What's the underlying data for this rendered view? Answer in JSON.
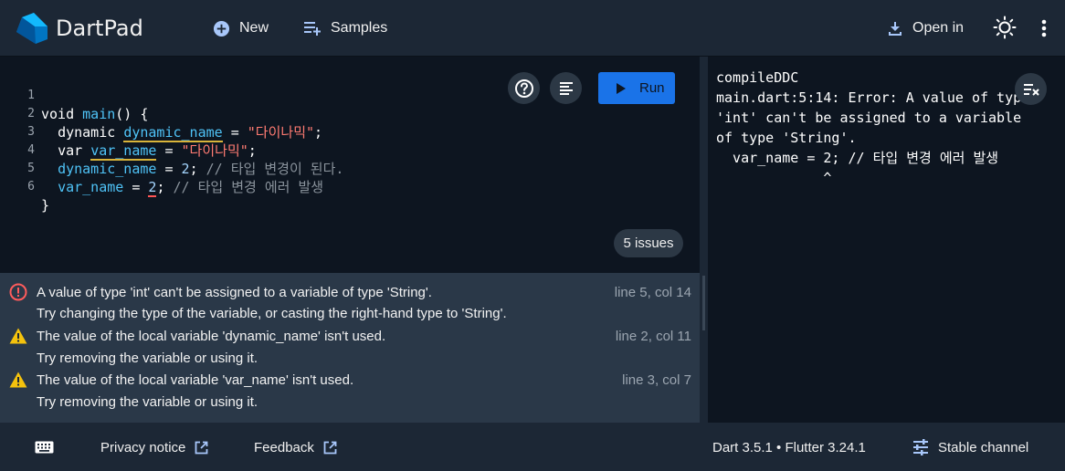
{
  "header": {
    "title": "DartPad",
    "new_label": "New",
    "samples_label": "Samples",
    "open_in_label": "Open in"
  },
  "editor": {
    "lines": [
      {
        "num": "1"
      },
      {
        "num": "2"
      },
      {
        "num": "3"
      },
      {
        "num": "4"
      },
      {
        "num": "5"
      },
      {
        "num": "6"
      }
    ],
    "tokens": {
      "void": "void",
      "main": "main",
      "main_rest": "() {",
      "dynamic": "dynamic",
      "dynamic_name": "dynamic_name",
      "eq": " = ",
      "str1": "\"다이나믹\"",
      "semi": ";",
      "var": "var",
      "var_name": "var_name",
      "num2": "2",
      "comment4": "// 타입 변경이 된다.",
      "comment5": "// 타입 변경 에러 발생",
      "close": "}"
    },
    "run_label": "Run",
    "issues_label": "5 issues"
  },
  "problems": [
    {
      "severity": "error",
      "message": "A value of type 'int' can't be assigned to a variable of type 'String'.",
      "location": "line 5, col 14",
      "fix": "Try changing the type of the variable, or casting the right-hand type to 'String'."
    },
    {
      "severity": "warning",
      "message": "The value of the local variable 'dynamic_name' isn't used.",
      "location": "line 2, col 11",
      "fix": "Try removing the variable or using it."
    },
    {
      "severity": "warning",
      "message": "The value of the local variable 'var_name' isn't used.",
      "location": "line 3, col 7",
      "fix": "Try removing the variable or using it."
    }
  ],
  "console": {
    "output": "compileDDC\nmain.dart:5:14: Error: A value of type\n'int' can't be assigned to a variable\nof type 'String'.\n  var_name = 2; // 타입 변경 에러 발생\n             ^"
  },
  "footer": {
    "privacy_label": "Privacy notice",
    "feedback_label": "Feedback",
    "version_label": "Dart 3.5.1 • Flutter 3.24.1",
    "channel_label": "Stable channel"
  },
  "colors": {
    "accent": "#1a73e8",
    "error": "#ff5555",
    "warning": "#f4c20d",
    "string": "#ff7b72",
    "identifier": "#4fc3f7"
  }
}
